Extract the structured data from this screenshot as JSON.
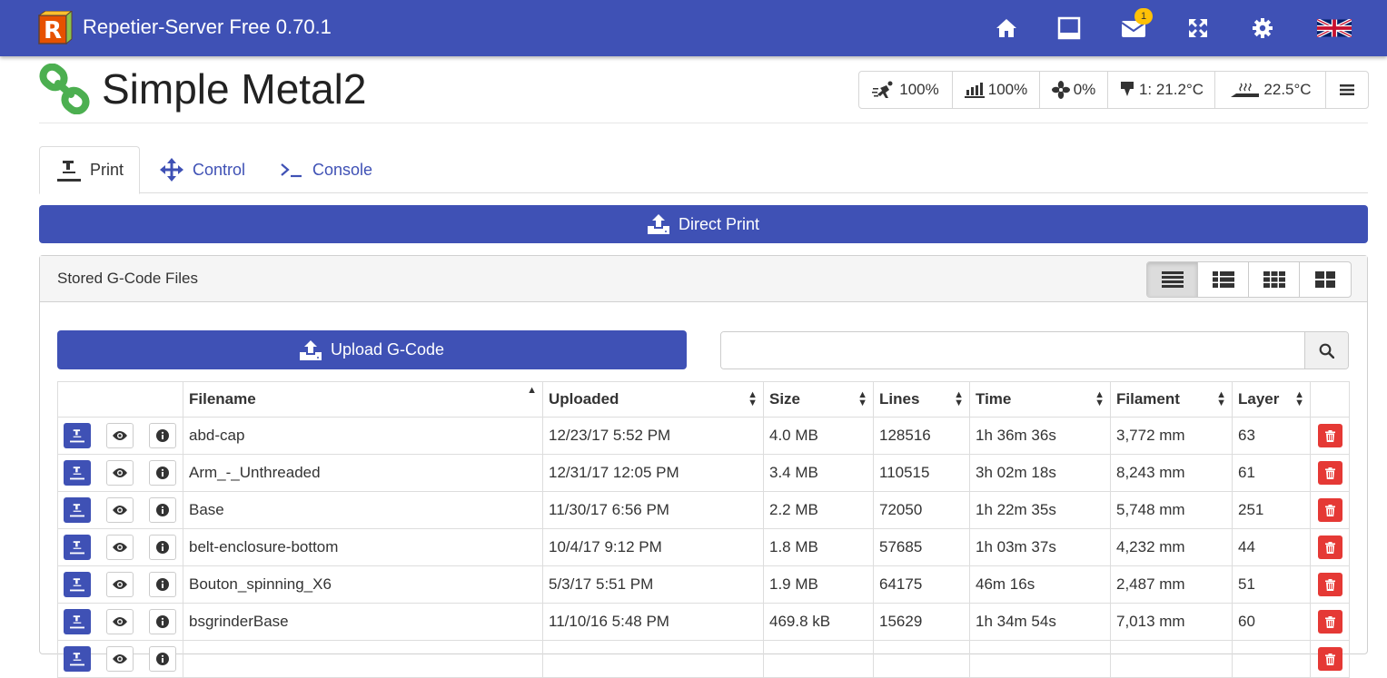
{
  "app": {
    "title": "Repetier-Server Free 0.70.1",
    "logo_letter": "R"
  },
  "nav": {
    "message_count": "1"
  },
  "printer": {
    "name": "Simple Metal2"
  },
  "status": [
    {
      "icon": "speed-icon",
      "value": "100%"
    },
    {
      "icon": "flow-icon",
      "value": "100%"
    },
    {
      "icon": "fan-icon",
      "value": "0%"
    },
    {
      "icon": "extruder-temp-icon",
      "value": "1: 21.2°C"
    },
    {
      "icon": "bed-temp-icon",
      "value": "22.5°C"
    }
  ],
  "tabs": [
    {
      "label": "Print",
      "active": true
    },
    {
      "label": "Control",
      "active": false
    },
    {
      "label": "Console",
      "active": false
    }
  ],
  "direct_print": {
    "label": "Direct Print"
  },
  "panel": {
    "title": "Stored G-Code Files"
  },
  "upload": {
    "label": "Upload G-Code"
  },
  "search": {
    "value": "",
    "placeholder": ""
  },
  "table": {
    "headers": [
      "Filename",
      "Uploaded",
      "Size",
      "Lines",
      "Time",
      "Filament",
      "Layer"
    ],
    "rows": [
      [
        "abd-cap",
        "12/23/17 5:52 PM",
        "4.0 MB",
        "128516",
        "1h 36m 36s",
        "3,772 mm",
        "63"
      ],
      [
        "Arm_-_Unthreaded",
        "12/31/17 12:05 PM",
        "3.4 MB",
        "110515",
        "3h 02m 18s",
        "8,243 mm",
        "61"
      ],
      [
        "Base",
        "11/30/17 6:56 PM",
        "2.2 MB",
        "72050",
        "1h 22m 35s",
        "5,748 mm",
        "251"
      ],
      [
        "belt-enclosure-bottom",
        "10/4/17 9:12 PM",
        "1.8 MB",
        "57685",
        "1h 03m 37s",
        "4,232 mm",
        "44"
      ],
      [
        "Bouton_spinning_X6",
        "5/3/17 5:51 PM",
        "1.9 MB",
        "64175",
        "46m 16s",
        "2,487 mm",
        "51"
      ],
      [
        "bsgrinderBase",
        "11/10/16 5:48 PM",
        "469.8 kB",
        "15629",
        "1h 34m 54s",
        "7,013 mm",
        "60"
      ],
      [
        "",
        "",
        "",
        "",
        "",
        "",
        ""
      ]
    ]
  },
  "colors": {
    "primary": "#3f51b5",
    "danger": "#e53935",
    "badge": "#ffc107",
    "printer_icon": "#4caf50"
  }
}
